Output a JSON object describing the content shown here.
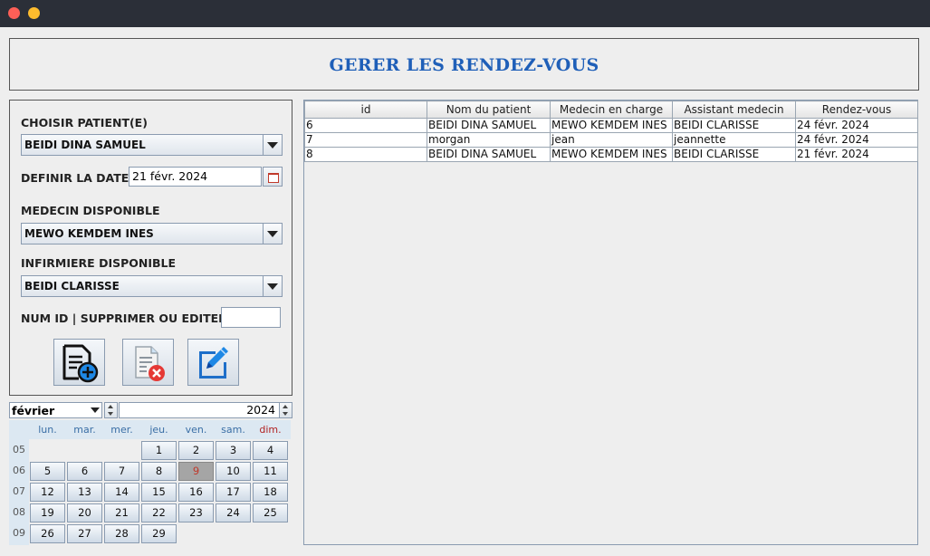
{
  "window": {
    "title": ""
  },
  "header": {
    "title": "GERER LES RENDEZ-VOUS"
  },
  "form": {
    "patient_label": "CHOISIR PATIENT(E)",
    "patient_value": "BEIDI DINA SAMUEL",
    "date_label": "DEFINIR LA DATE",
    "date_value": "21 févr. 2024",
    "doctor_label": "MEDECIN DISPONIBLE",
    "doctor_value": "MEWO KEMDEM INES",
    "nurse_label": "INFIRMIERE DISPONIBLE",
    "nurse_value": "BEIDI CLARISSE",
    "id_label": "NUM ID | SUPPRIMER OU EDITER",
    "id_value": ""
  },
  "calendar": {
    "month": "février",
    "year": "2024",
    "weekdays": [
      "lun.",
      "mar.",
      "mer.",
      "jeu.",
      "ven.",
      "sam.",
      "dim."
    ],
    "weeks": [
      "05",
      "06",
      "07",
      "08",
      "09"
    ],
    "days": [
      "1",
      "2",
      "3",
      "4",
      "5",
      "6",
      "7",
      "8",
      "9",
      "10",
      "11",
      "12",
      "13",
      "14",
      "15",
      "16",
      "17",
      "18",
      "19",
      "20",
      "21",
      "22",
      "23",
      "24",
      "25",
      "26",
      "27",
      "28",
      "29"
    ],
    "selected_day": "9"
  },
  "table": {
    "headers": [
      "id",
      "Nom du patient",
      "Medecin en charge",
      "Assistant medecin",
      "Rendez-vous"
    ],
    "rows": [
      [
        "6",
        "BEIDI DINA SAMUEL",
        "MEWO KEMDEM INES",
        "BEIDI CLARISSE",
        "24 févr. 2024"
      ],
      [
        "7",
        "morgan",
        "jean",
        "jeannette",
        "24 févr. 2024"
      ],
      [
        "8",
        "BEIDI DINA SAMUEL",
        "MEWO KEMDEM INES",
        "BEIDI CLARISSE",
        "21 févr. 2024"
      ]
    ]
  },
  "icons": [
    "add-document-icon",
    "delete-document-icon",
    "edit-pencil-icon",
    "calendar-icon",
    "chevron-down-icon"
  ],
  "colors": {
    "title": "#1f5fb8",
    "accent": "#1e88e5",
    "delete": "#e53935"
  }
}
